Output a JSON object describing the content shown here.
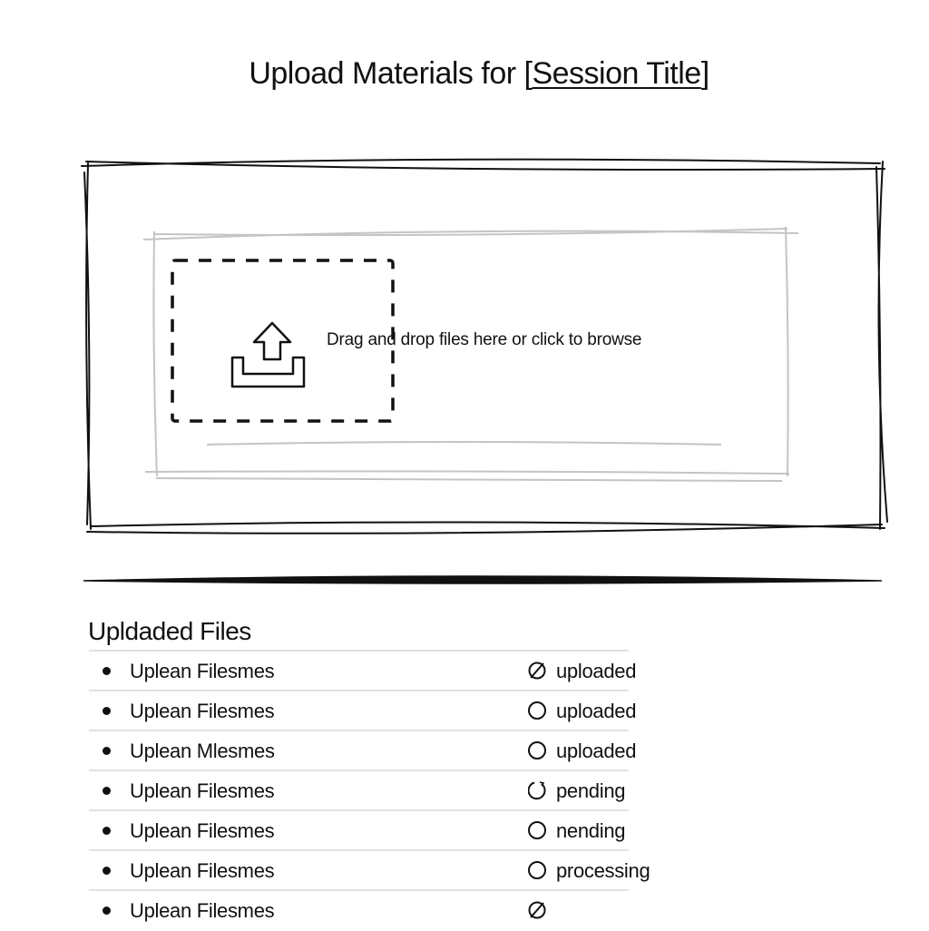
{
  "header": {
    "title_prefix": "Upload Materials for ",
    "open_bracket": "[",
    "session_title": "Session Title",
    "close_bracket": "]"
  },
  "dropzone": {
    "icon": "upload-tray-icon",
    "instruction": "Drag and drop files here or click to browse"
  },
  "files": {
    "heading": "Upldaded Files",
    "items": [
      {
        "name": "Uplean Filesmes",
        "status": "uploaded",
        "status_icon": "slashed-circle"
      },
      {
        "name": "Uplean Filesmes",
        "status": "uploaded",
        "status_icon": "circle"
      },
      {
        "name": "Uplean Mlesmes",
        "status": "uploaded",
        "status_icon": "circle"
      },
      {
        "name": "Uplean Filesmes",
        "status": "pending",
        "status_icon": "refresh-circle"
      },
      {
        "name": "Uplean Filesmes",
        "status": "nending",
        "status_icon": "circle"
      },
      {
        "name": "Uplean Filesmes",
        "status": "processing",
        "status_icon": "circle"
      },
      {
        "name": "Uplean Filesmes",
        "status": "",
        "status_icon": "slashed-circle"
      }
    ]
  }
}
